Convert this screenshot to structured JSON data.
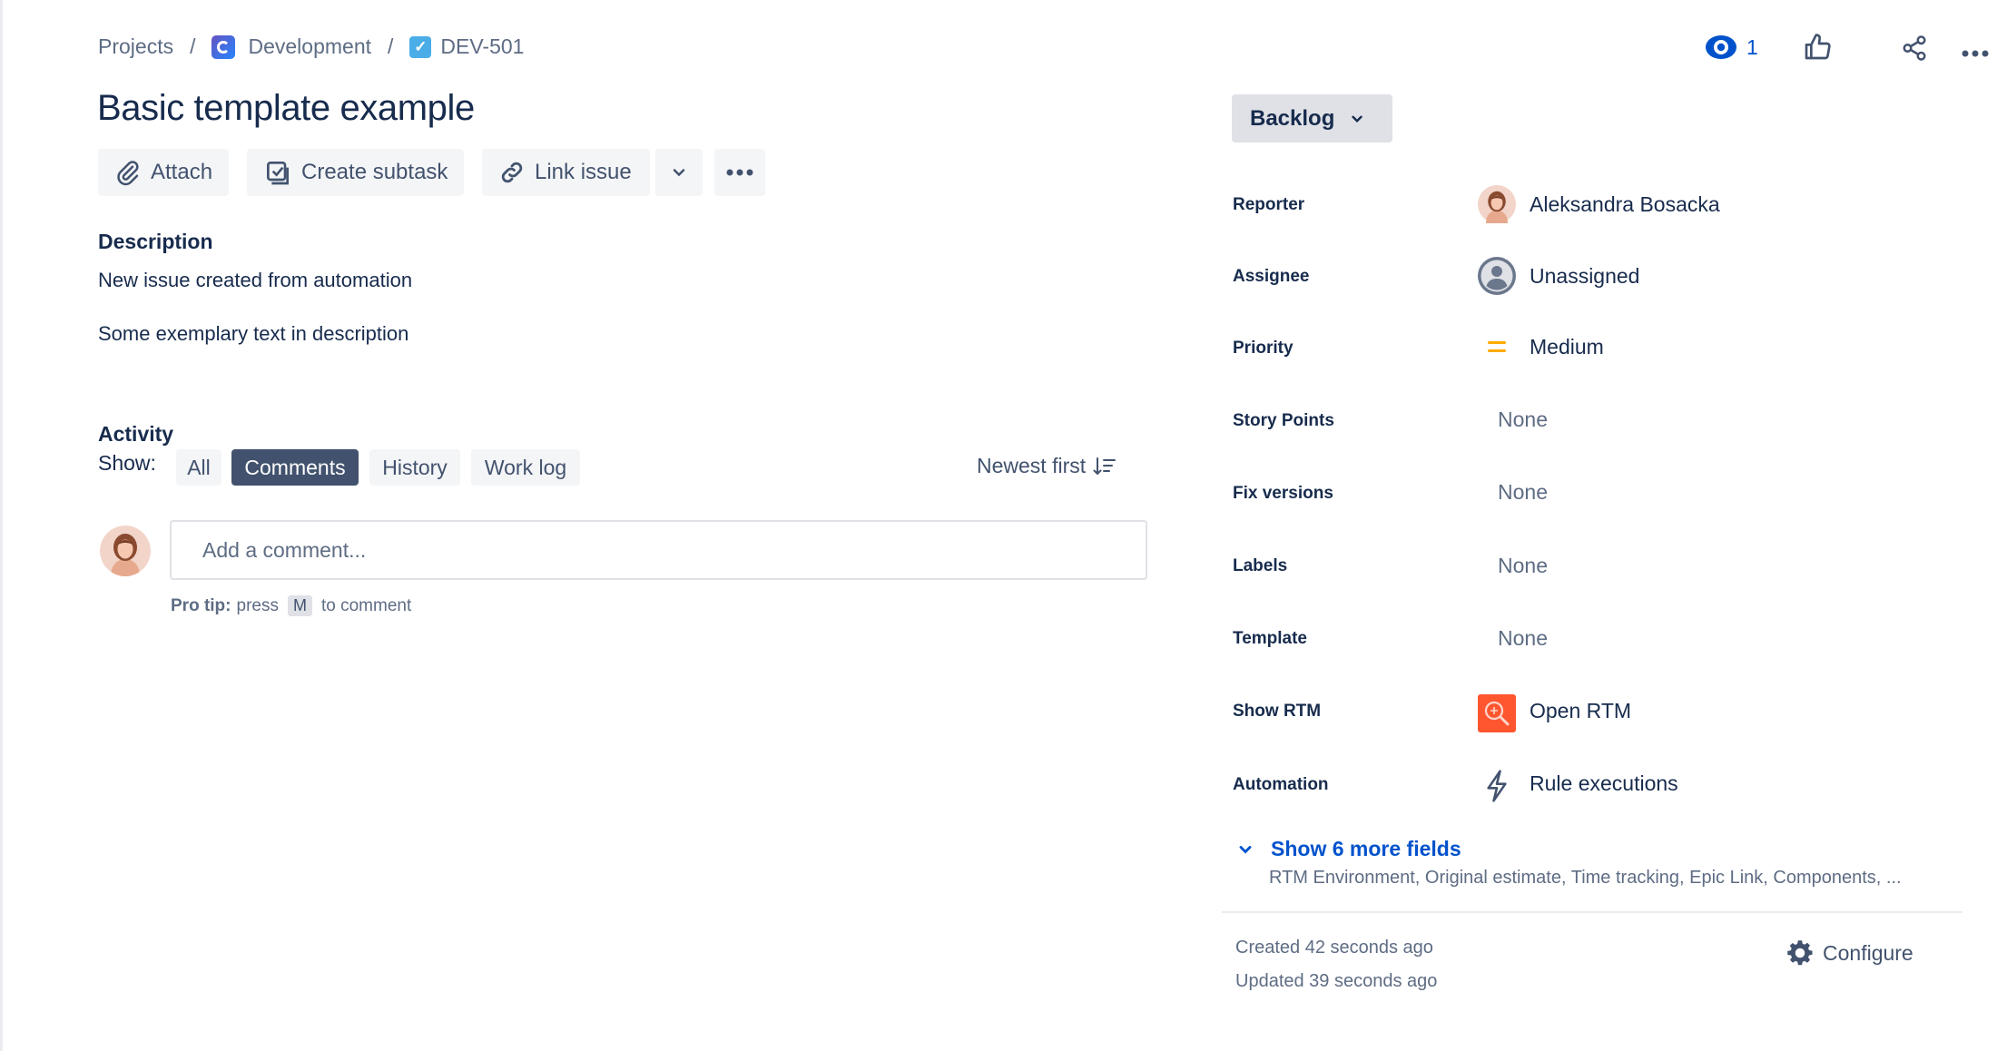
{
  "breadcrumb": {
    "projects": "Projects",
    "separator": "/",
    "project": "Development",
    "issue_key": "DEV-501"
  },
  "issue": {
    "title": "Basic template example"
  },
  "toolbar": {
    "attach": "Attach",
    "create_subtask": "Create subtask",
    "link_issue": "Link issue"
  },
  "description": {
    "heading": "Description",
    "line1": "New issue created from automation",
    "line2": "Some exemplary text in description"
  },
  "activity": {
    "heading": "Activity",
    "show_label": "Show:",
    "tabs": [
      "All",
      "Comments",
      "History",
      "Work log"
    ],
    "active_tab": "Comments",
    "sort": "Newest first",
    "comment_placeholder": "Add a comment...",
    "protip_bold": "Pro tip:",
    "protip_pre": "press",
    "protip_key": "M",
    "protip_post": "to comment"
  },
  "header_actions": {
    "watch_count": "1"
  },
  "status": {
    "label": "Backlog"
  },
  "fields": {
    "reporter": {
      "label": "Reporter",
      "value": "Aleksandra Bosacka"
    },
    "assignee": {
      "label": "Assignee",
      "value": "Unassigned"
    },
    "priority": {
      "label": "Priority",
      "value": "Medium",
      "color": "#ffab00"
    },
    "story_points": {
      "label": "Story Points",
      "value": "None"
    },
    "fix_versions": {
      "label": "Fix versions",
      "value": "None"
    },
    "labels": {
      "label": "Labels",
      "value": "None"
    },
    "template": {
      "label": "Template",
      "value": "None"
    },
    "show_rtm": {
      "label": "Show RTM",
      "value": "Open RTM",
      "icon_color": "#ff5630"
    },
    "automation": {
      "label": "Automation",
      "value": "Rule executions"
    }
  },
  "more_fields": {
    "toggle": "Show 6 more fields",
    "list": "RTM Environment, Original estimate, Time tracking, Epic Link, Components, ..."
  },
  "meta": {
    "created": "Created 42 seconds ago",
    "updated": "Updated 39 seconds ago",
    "configure": "Configure"
  },
  "colors": {
    "link": "#0052cc",
    "text": "#172b4d",
    "subtle": "#5e6c84",
    "button_bg": "#f4f5f7",
    "active_tab_bg": "#42526e"
  }
}
